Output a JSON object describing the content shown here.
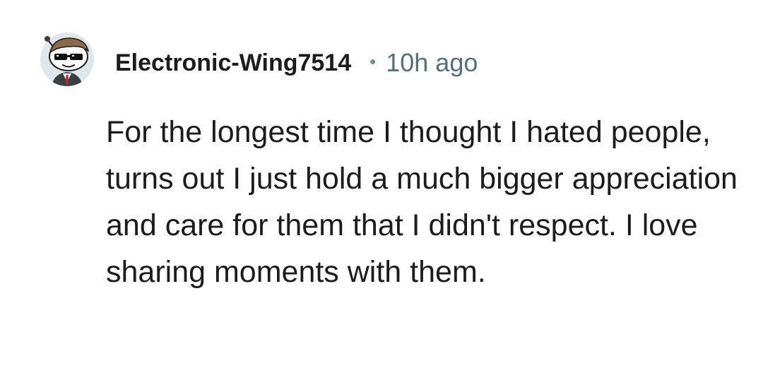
{
  "comment": {
    "author": "Electronic-Wing7514",
    "separator": "•",
    "timestamp": "10h ago",
    "body": "For the longest time I thought I hated people, turns out I just hold a much bigger appreciation and care for them that I didn't respect. I love sharing moments with them.",
    "avatar_icon": "snoo-avatar-with-sunglasses-icon"
  },
  "colors": {
    "text": "#1c1c1c",
    "meta": "#576f76",
    "avatar_bg": "#dfe7ea"
  }
}
